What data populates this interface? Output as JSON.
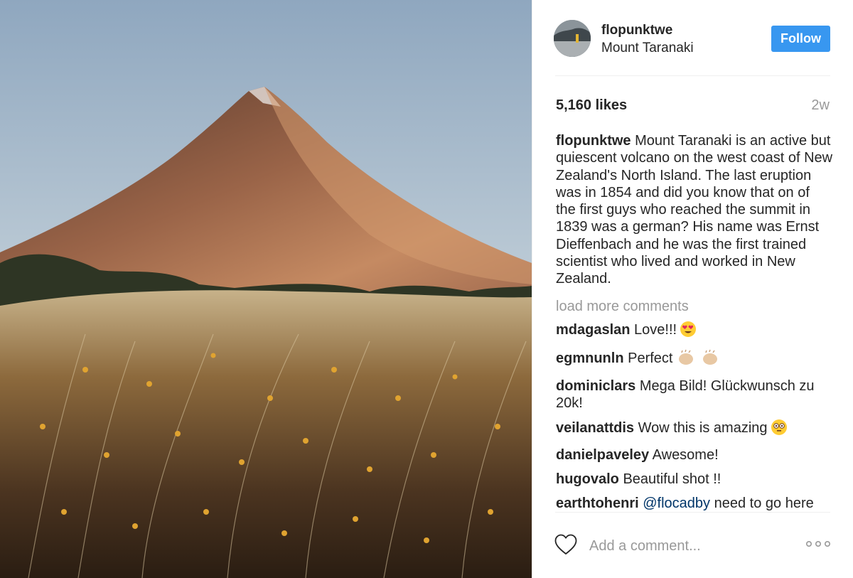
{
  "post": {
    "username": "flopunktwe",
    "location": "Mount Taranaki",
    "follow_label": "Follow",
    "likes": "5,160 likes",
    "time_ago": "2w"
  },
  "caption": {
    "username": "flopunktwe",
    "text": "Mount Taranaki is an active but quiescent volcano on the west coast of New Zealand's North Island. The last eruption was in 1854 and did you know that on of the first guys who reached the summit in 1839 was a german? His name was Ernst Dieffenbach and he was the first trained scientist who lived and worked in New Zealand."
  },
  "load_more_label": "load more comments",
  "comments": [
    {
      "username": "mdagaslan",
      "text": "Love!!!",
      "emoji": "heart-eyes-emoji"
    },
    {
      "username": "egmnunln",
      "text": "Perfect",
      "emoji": "clapping-hands-emoji"
    },
    {
      "username": "dominiclars",
      "text": "Mega Bild! Glückwunsch zu 20k!"
    },
    {
      "username": "veilanattdis",
      "text": "Wow this is amazing",
      "emoji": "flushed-face-emoji"
    },
    {
      "username": "danielpaveley",
      "text": "Awesome!"
    },
    {
      "username": "hugovalo",
      "text": "Beautiful shot !!"
    },
    {
      "username": "earthtohenri",
      "mention": "@flocadby",
      "text": "need to go here big time"
    }
  ],
  "comment_box": {
    "placeholder": "Add a comment..."
  },
  "icons": {
    "like": "heart-icon",
    "more": "more-options-icon"
  },
  "colors": {
    "follow_button": "#3897f0",
    "mention": "#003569",
    "muted_text": "#999999"
  }
}
